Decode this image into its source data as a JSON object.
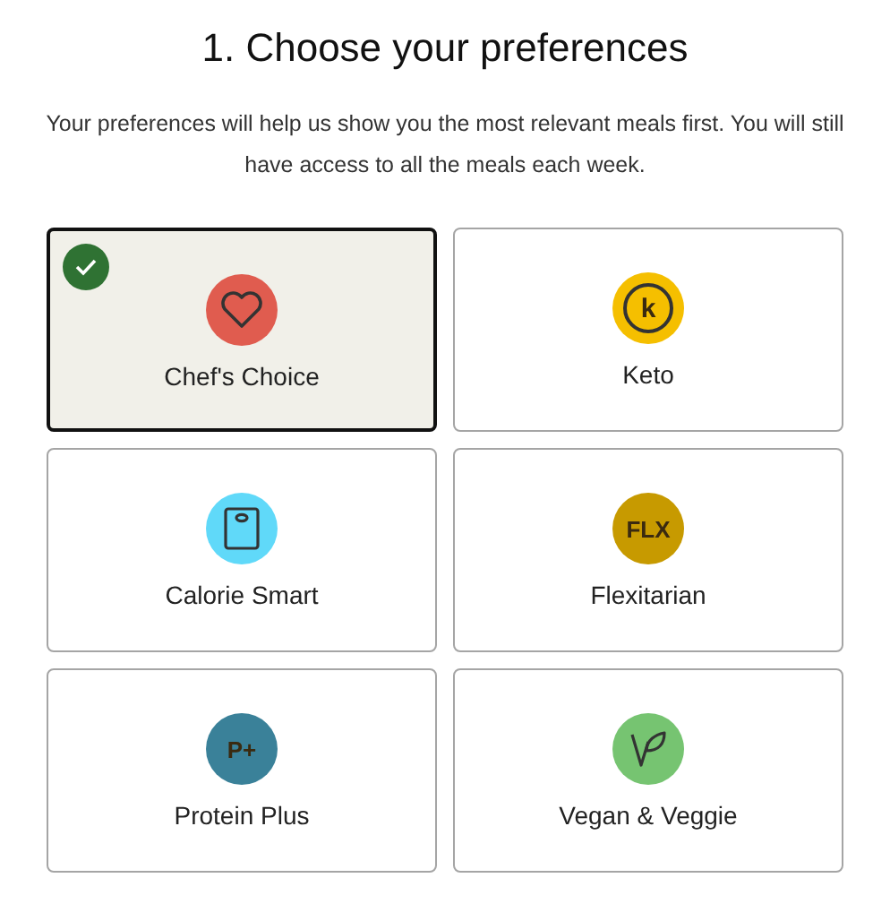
{
  "title": "1. Choose your preferences",
  "subtitle": "Your preferences will help us show you the most relevant meals first. You will still have access to all the meals each week.",
  "preferences": [
    {
      "label": "Chef's Choice",
      "selected": true,
      "kind": "heart",
      "color": "#e05c4f"
    },
    {
      "label": "Keto",
      "selected": false,
      "kind": "letter",
      "color": "#f5bf00",
      "icon_text": "k"
    },
    {
      "label": "Calorie Smart",
      "selected": false,
      "kind": "scale",
      "color": "#60d9f9"
    },
    {
      "label": "Flexitarian",
      "selected": false,
      "kind": "letter",
      "color": "#c79a00",
      "icon_text": "FLX"
    },
    {
      "label": "Protein Plus",
      "selected": false,
      "kind": "letter",
      "color": "#3a8199",
      "icon_text": "P+"
    },
    {
      "label": "Vegan & Veggie",
      "selected": false,
      "kind": "leaf",
      "color": "#76c471"
    }
  ]
}
